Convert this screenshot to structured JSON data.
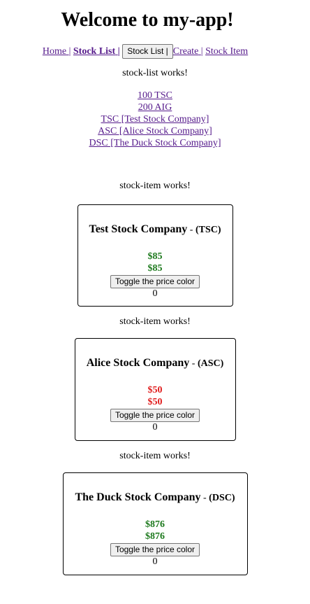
{
  "app": {
    "title": "Welcome to my-app!"
  },
  "nav": {
    "home_label": "Home",
    "separator": "|",
    "stock_list_label": "Stock List",
    "stock_list_button_label": "Stock List |",
    "create_label": "Create",
    "stock_item_label": "Stock Item"
  },
  "stock_list": {
    "works_text": "stock-list works!",
    "entries": [
      "100 TSC",
      "200 AIG",
      "TSC [Test Stock Company]",
      "ASC [Alice Stock Company]",
      "DSC [The Duck Stock Company]"
    ]
  },
  "stock_items": [
    {
      "works_text": "stock-item works!",
      "name": "Test Stock Company",
      "separator": " - ",
      "code": "(TSC)",
      "price": "$85",
      "price_repeat": "$85",
      "price_color": "#1e7a1e",
      "toggle_label": "Toggle the price color",
      "counter": "0"
    },
    {
      "works_text": "stock-item works!",
      "name": "Alice Stock Company",
      "separator": " - ",
      "code": "(ASC)",
      "price": "$50",
      "price_repeat": "$50",
      "price_color": "#e01b1b",
      "toggle_label": "Toggle the price color",
      "counter": "0"
    },
    {
      "works_text": "stock-item works!",
      "name": "The Duck Stock Company",
      "separator": " - ",
      "code": "(DSC)",
      "price": "$876",
      "price_repeat": "$876",
      "price_color": "#1e7a1e",
      "toggle_label": "Toggle the price color",
      "counter": "0"
    }
  ],
  "colors": {
    "link": "#551a8b",
    "price_up": "#1e7a1e",
    "price_down": "#e01b1b"
  }
}
